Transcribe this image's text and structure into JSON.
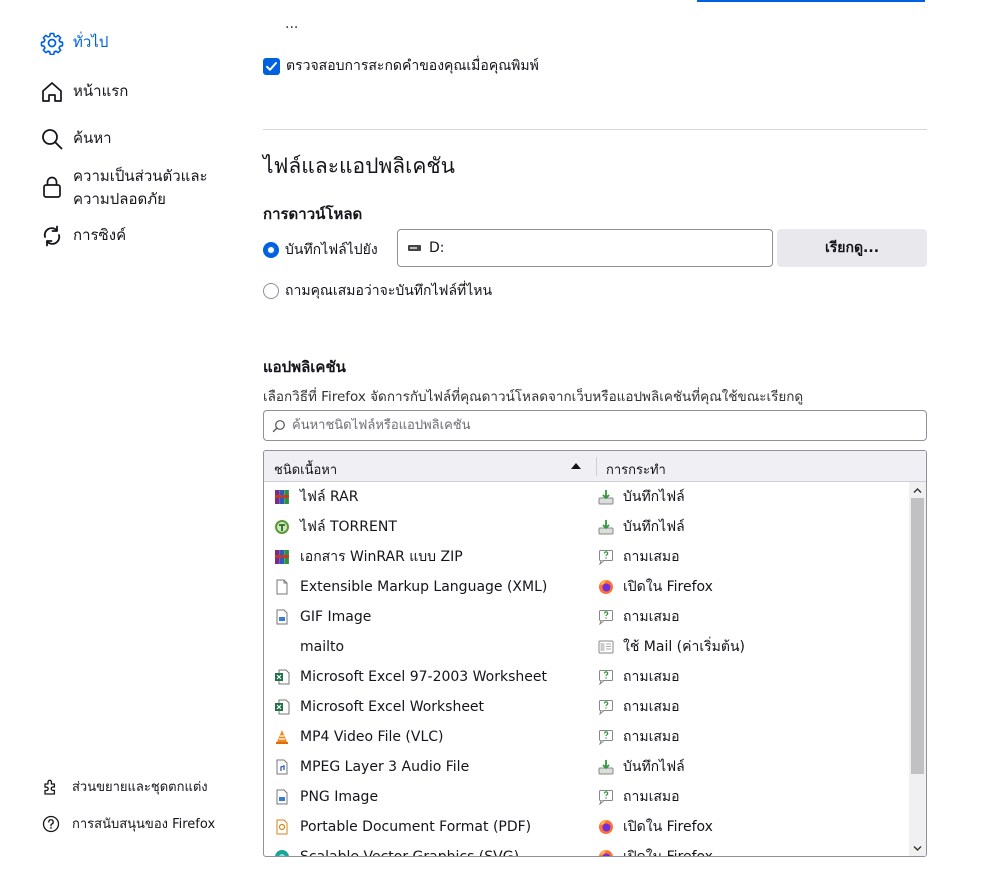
{
  "sidebar": {
    "items": [
      {
        "label": "ทั่วไป",
        "icon": "gear-icon",
        "active": true
      },
      {
        "label": "หน้าแรก",
        "icon": "home-icon"
      },
      {
        "label": "ค้นหา",
        "icon": "search-icon"
      },
      {
        "label": "ความเป็นส่วนตัวและ",
        "label2": "ความปลอดภัย",
        "icon": "lock-icon"
      },
      {
        "label": "การซิงค์",
        "icon": "sync-icon"
      }
    ],
    "footer": [
      {
        "label": "ส่วนขยายและชุดตกแต่ง",
        "icon": "puzzle-icon"
      },
      {
        "label": "การสนับสนุนของ Firefox",
        "icon": "help-icon"
      }
    ]
  },
  "main": {
    "ellipsis": "...",
    "spellcheck_label": "ตรวจสอบการสะกดคำของคุณเมื่อคุณพิมพ์",
    "section_title": "ไฟล์และแอปพลิเคชัน",
    "downloads": {
      "heading": "การดาวน์โหลด",
      "save_to_label": "บันทึกไฟล์ไปยัง",
      "path": "D:",
      "browse_label": "เรียกดู...",
      "always_ask_label": "ถามคุณเสมอว่าจะบันทึกไฟล์ที่ไหน"
    },
    "applications": {
      "heading": "แอปพลิเคชัน",
      "description": "เลือกวิธีที่ Firefox จัดการกับไฟล์ที่คุณดาวน์โหลดจากเว็บหรือแอปพลิเคชันที่คุณใช้ขณะเรียกดู",
      "search_placeholder": "ค้นหาชนิดไฟล์หรือแอปพลิเคชัน",
      "col_type": "ชนิดเนื้อหา",
      "col_action": "การกระทำ",
      "rows": [
        {
          "type": "ไฟล์ RAR",
          "type_icon": "winrar-icon",
          "action": "บันทึกไฟล์",
          "action_icon": "save-file-icon"
        },
        {
          "type": "ไฟล์ TORRENT",
          "type_icon": "torrent-icon",
          "action": "บันทึกไฟล์",
          "action_icon": "save-file-icon"
        },
        {
          "type": "เอกสาร WinRAR แบบ ZIP",
          "type_icon": "winrar-icon",
          "action": "ถามเสมอ",
          "action_icon": "ask-icon"
        },
        {
          "type": "Extensible Markup Language (XML)",
          "type_icon": "file-icon",
          "action": "เปิดใน Firefox",
          "action_icon": "firefox-icon"
        },
        {
          "type": "GIF Image",
          "type_icon": "image-file-icon",
          "action": "ถามเสมอ",
          "action_icon": "ask-icon"
        },
        {
          "type": "mailto",
          "type_icon": "none",
          "action": "ใช้ Mail (ค่าเริ่มต้น)",
          "action_icon": "mail-app-icon"
        },
        {
          "type": "Microsoft Excel 97-2003 Worksheet",
          "type_icon": "excel-icon",
          "action": "ถามเสมอ",
          "action_icon": "ask-icon"
        },
        {
          "type": "Microsoft Excel Worksheet",
          "type_icon": "excel-icon",
          "action": "ถามเสมอ",
          "action_icon": "ask-icon"
        },
        {
          "type": "MP4 Video File (VLC)",
          "type_icon": "vlc-icon",
          "action": "ถามเสมอ",
          "action_icon": "ask-icon"
        },
        {
          "type": "MPEG Layer 3 Audio File",
          "type_icon": "audio-file-icon",
          "action": "บันทึกไฟล์",
          "action_icon": "save-file-icon"
        },
        {
          "type": "PNG Image",
          "type_icon": "image-file-icon",
          "action": "ถามเสมอ",
          "action_icon": "ask-icon"
        },
        {
          "type": "Portable Document Format (PDF)",
          "type_icon": "pdf-icon",
          "action": "เปิดใน Firefox",
          "action_icon": "firefox-icon"
        },
        {
          "type": "Scalable Vector Graphics (SVG)",
          "type_icon": "svg-icon",
          "action": "เปิดใน Firefox",
          "action_icon": "firefox-icon"
        }
      ]
    }
  },
  "colors": {
    "accent": "#0061e0",
    "button_bg": "#e9e9ed",
    "border": "#8f8f9d"
  }
}
